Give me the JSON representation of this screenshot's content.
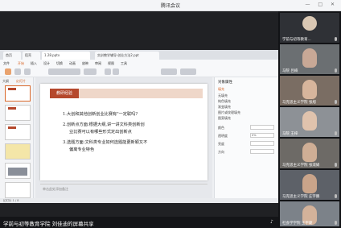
{
  "window": {
    "title": "腾讯会议",
    "controls": "— □ ✕"
  },
  "app": {
    "tabs": [
      "首页",
      "稻壳",
      "1.28.pptx",
      "实训教学辅导·创业方法2.ppt"
    ],
    "ribbon_menu": [
      "文件",
      "开始",
      "插入",
      "设计",
      "切换",
      "动画",
      "放映",
      "审阅",
      "视图",
      "工具"
    ],
    "panel_tabs": [
      "大纲",
      "幻灯片"
    ],
    "slide": {
      "title": "教研经验",
      "lines": [
        "1.大创和其他创新创业比赛有\"一定联吗?",
        "2.创新点方面:根据大纲,讲一讲文科类创新创",
        "业比赛可以有哪些形式定出创新点",
        "3.选题方面:文科类专业如何选题能更新颖又不",
        "偏离专业特色"
      ]
    },
    "notes": "单击此处添加备注",
    "props": {
      "header": "对象属性",
      "section": "填充",
      "options": [
        "无填充",
        "纯色填充",
        "渐变填充",
        "图片或纹理填充",
        "图案填充"
      ],
      "rows": [
        {
          "label": "颜色",
          "value": ""
        },
        {
          "label": "透明度",
          "value": "0%"
        },
        {
          "label": "亮度",
          "value": ""
        },
        {
          "label": "方向",
          "value": ""
        }
      ]
    },
    "status": "幻灯片 1 / 8"
  },
  "speaker": {
    "label": "学前与初等教育学院 刘佳迪的屏幕共享"
  },
  "participants": [
    {
      "label": "学前与初等教育..."
    },
    {
      "label": "马院 吕楠"
    },
    {
      "label": "马克思主义学院 张旭"
    },
    {
      "label": "马院 王梓"
    },
    {
      "label": "马克思主义学院 张淑娟"
    },
    {
      "label": "马克思主义学院 庄宇鹏"
    },
    {
      "label": "社会学学院 王宇婕"
    }
  ],
  "colors": {
    "accent": "#b5482c",
    "bg": "#1c1d21"
  }
}
